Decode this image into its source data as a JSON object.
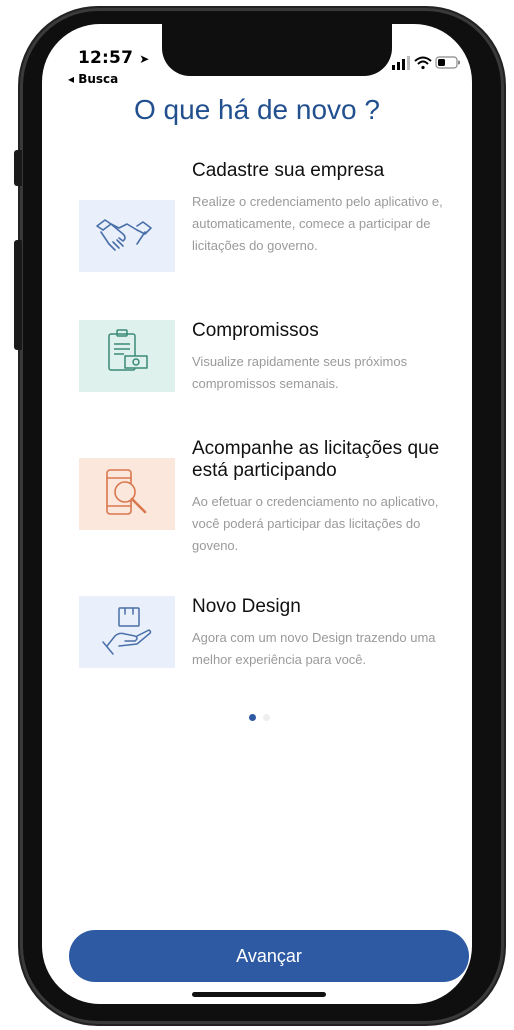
{
  "status_bar": {
    "time": "12:57",
    "back_label": "◂ Busca"
  },
  "page": {
    "title": "O que há de novo ?"
  },
  "features": [
    {
      "icon": "handshake-icon",
      "tile_color": "#e9f0fb",
      "title": "Cadastre sua empresa",
      "description": "Realize o credenciamento pelo aplicativo e, automaticamente, comece a participar de licitações do governo."
    },
    {
      "icon": "clipboard-money-icon",
      "tile_color": "#dff1ec",
      "title": "Compromissos",
      "description": "Visualize rapidamente seus próximos compromissos semanais."
    },
    {
      "icon": "phone-search-icon",
      "tile_color": "#fbe7dc",
      "title": "Acompanhe as licitações que está participando",
      "description": "Ao efetuar o credenciamento no aplicativo, você poderá participar das licitações do goveno."
    },
    {
      "icon": "hand-box-icon",
      "tile_color": "#e9f0fb",
      "title": "Novo Design",
      "description": "Agora com um novo Design trazendo uma melhor experiência para você."
    }
  ],
  "pagination": {
    "current": 1,
    "total": 2
  },
  "footer": {
    "button_label": "Avançar"
  },
  "colors": {
    "primary": "#2e5aa3",
    "title": "#22508f",
    "muted_text": "#9a9a9a"
  }
}
